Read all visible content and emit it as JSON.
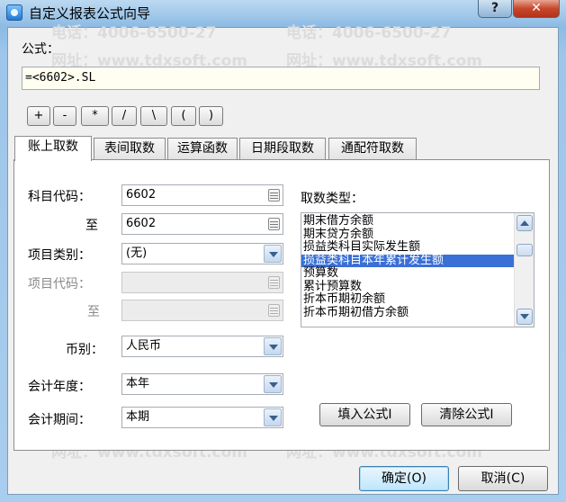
{
  "window": {
    "title": "自定义报表公式向导",
    "help_label": "?",
    "close_label": "✕"
  },
  "watermark": {
    "phone": "电话：4006-6500-27",
    "site": "网址：www.tdxsoft.com"
  },
  "formula": {
    "label": "公式：",
    "value": "=<6602>.SL"
  },
  "operators": [
    "+",
    "-",
    "*",
    "/",
    "\\",
    "(",
    ")"
  ],
  "tabs": [
    "账上取数",
    "表间取数",
    "运算函数",
    "日期段取数",
    "通配符取数"
  ],
  "form": {
    "subject_code_label": "科目代码：",
    "subject_code_value": "6602",
    "to_label": "至",
    "subject_code_to_value": "6602",
    "item_category_label": "项目类别：",
    "item_category_value": "(无)",
    "item_code_label": "项目代码：",
    "item_code_to_label": "至",
    "currency_label": "币别：",
    "currency_value": "人民币",
    "fiscal_year_label": "会计年度：",
    "fiscal_year_value": "本年",
    "period_label": "会计期间：",
    "period_value": "本期"
  },
  "fetch_type": {
    "label": "取数类型：",
    "items": [
      "期末借方余额",
      "期末贷方余额",
      "损益类科目实际发生额",
      "损益类科目本年累计发生额",
      "预算数",
      "累计预算数",
      "折本币期初余额",
      "折本币期初借方余额"
    ],
    "selected_index": 3
  },
  "actions": {
    "fill_formula": "填入公式I",
    "clear_formula": "清除公式I"
  },
  "footer": {
    "ok": "确定(O)",
    "cancel": "取消(C)"
  }
}
